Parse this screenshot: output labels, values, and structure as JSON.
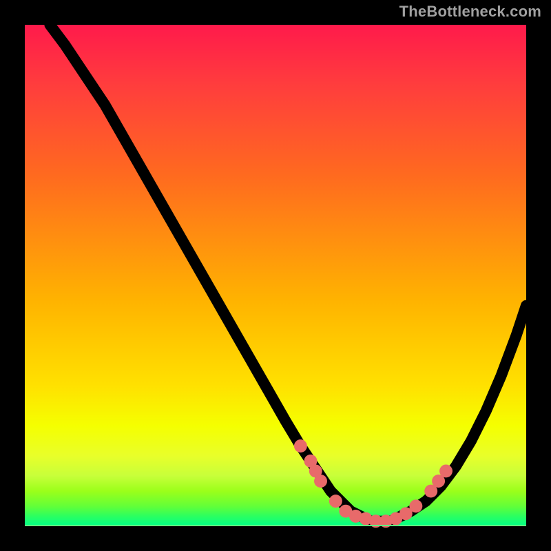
{
  "watermark": "TheBottleneck.com",
  "colors": {
    "page_bg": "#000000",
    "gradient_top": "#ff1a4b",
    "gradient_bottom": "#00ff88",
    "line": "#000000",
    "dot": "#e86a6a",
    "watermark": "#a0a0a0"
  },
  "chart_data": {
    "type": "line",
    "title": "",
    "xlabel": "",
    "ylabel": "",
    "xlim": [
      0,
      100
    ],
    "ylim": [
      0,
      100
    ],
    "grid": false,
    "legend": false,
    "series": [
      {
        "name": "curve",
        "x": [
          5,
          8,
          12,
          16,
          20,
          24,
          28,
          32,
          36,
          40,
          44,
          48,
          52,
          55,
          57,
          59,
          61,
          63,
          65,
          67,
          69,
          71,
          73,
          75,
          77,
          80,
          83,
          86,
          89,
          92,
          95,
          98,
          100
        ],
        "y": [
          100,
          96,
          90,
          84,
          77,
          70,
          63,
          56,
          49,
          42,
          35,
          28,
          21,
          16,
          13,
          10,
          7,
          5,
          3,
          2,
          1,
          1,
          1,
          2,
          3,
          5,
          8,
          12,
          17,
          23,
          30,
          38,
          44
        ]
      }
    ],
    "markers": [
      {
        "x": 55,
        "y": 16
      },
      {
        "x": 57,
        "y": 13
      },
      {
        "x": 58,
        "y": 11
      },
      {
        "x": 59,
        "y": 9
      },
      {
        "x": 62,
        "y": 5
      },
      {
        "x": 64,
        "y": 3
      },
      {
        "x": 66,
        "y": 2
      },
      {
        "x": 68,
        "y": 1.5
      },
      {
        "x": 70,
        "y": 1
      },
      {
        "x": 72,
        "y": 1
      },
      {
        "x": 74,
        "y": 1.5
      },
      {
        "x": 76,
        "y": 2.5
      },
      {
        "x": 78,
        "y": 4
      },
      {
        "x": 81,
        "y": 7
      },
      {
        "x": 82.5,
        "y": 9
      },
      {
        "x": 84,
        "y": 11
      }
    ]
  }
}
